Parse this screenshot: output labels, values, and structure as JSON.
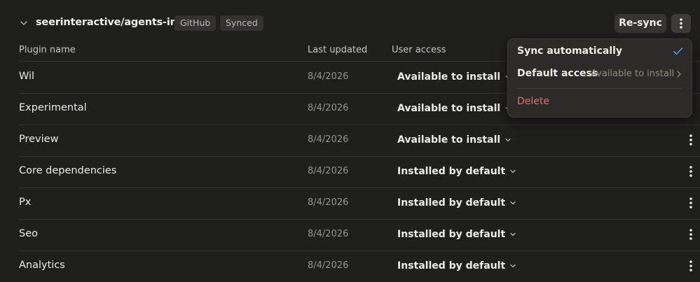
{
  "header": {
    "repo_name": "seerinteractive/agents-infra",
    "badges": [
      "GitHub",
      "Synced"
    ],
    "resync_label": "Re-sync"
  },
  "table": {
    "columns": [
      "Plugin name",
      "Last updated",
      "User access"
    ],
    "rows": [
      {
        "name": "Wil",
        "updated": "8/4/2026",
        "access": "Available to install"
      },
      {
        "name": "Experimental",
        "updated": "8/4/2026",
        "access": "Available to install"
      },
      {
        "name": "Preview",
        "updated": "8/4/2026",
        "access": "Available to install"
      },
      {
        "name": "Core dependencies",
        "updated": "8/4/2026",
        "access": "Installed by default"
      },
      {
        "name": "Px",
        "updated": "8/4/2026",
        "access": "Installed by default"
      },
      {
        "name": "Seo",
        "updated": "8/4/2026",
        "access": "Installed by default"
      },
      {
        "name": "Analytics",
        "updated": "8/4/2026",
        "access": "Installed by default"
      }
    ]
  },
  "menu": {
    "sync_auto": "Sync automatically",
    "sync_auto_checked": true,
    "default_access": "Default access",
    "default_access_value": "Available to install",
    "delete": "Delete"
  },
  "colors": {
    "background": "#1f1f1e",
    "accent_check": "#4d8ef0",
    "danger": "#d9726c"
  },
  "icons": [
    "chevron-down-icon",
    "more-vertical-icon",
    "check-icon",
    "chevron-right-icon"
  ]
}
